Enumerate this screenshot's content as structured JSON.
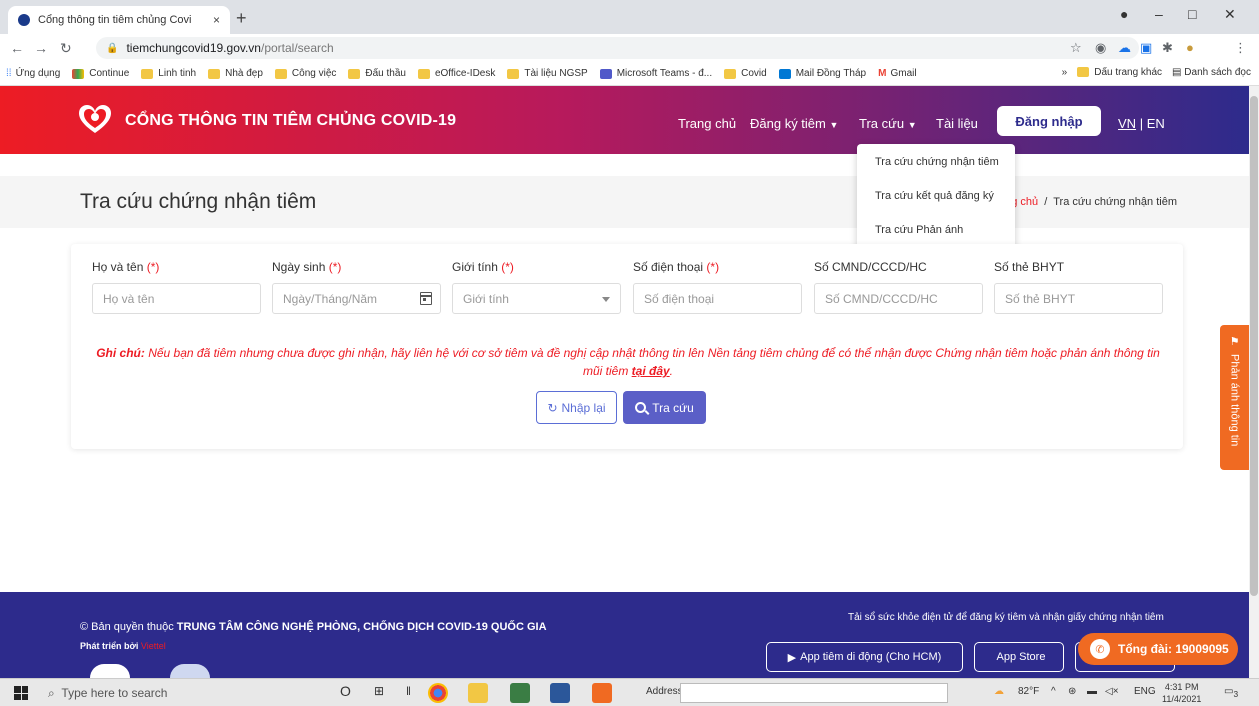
{
  "browser": {
    "tab_title": "Cổng thông tin tiêm chủng Covi",
    "tab_close": "×",
    "new_tab": "+",
    "url_host": "tiemchungcovid19.gov.vn",
    "url_path": "/portal/search",
    "bookmarks": [
      "Ứng dụng",
      "Continue",
      "Linh tinh",
      "Nhà đẹp",
      "Công việc",
      "Đấu thầu",
      "eOffice-IDesk",
      "Tài liệu NGSP",
      "Microsoft Teams - đ...",
      "Covid",
      "Mail Đồng Tháp",
      "Gmail"
    ],
    "bookmarks_more": "»",
    "bookmarks_other": "Dấu trang khác",
    "reading_list": "Danh sách đọc"
  },
  "header": {
    "site_title": "CỔNG THÔNG TIN TIÊM CHỦNG COVID-19",
    "nav": {
      "home": "Trang chủ",
      "register": "Đăng ký tiêm",
      "lookup": "Tra cứu",
      "docs": "Tài liệu"
    },
    "login": "Đăng nhập",
    "lang_vn": "VN",
    "lang_sep": "|",
    "lang_en": "EN"
  },
  "dropdown": {
    "items": [
      "Tra cứu chứng nhận tiêm",
      "Tra cứu kết quả đăng ký",
      "Tra cứu Phản ánh"
    ]
  },
  "page": {
    "title": "Tra cứu chứng nhận tiêm",
    "breadcrumb_home": "g chủ",
    "breadcrumb_sep": "/",
    "breadcrumb_current": "Tra cứu chứng nhận tiêm"
  },
  "form": {
    "fields": [
      {
        "label": "Họ và tên",
        "required": "(*)",
        "placeholder": "Họ và tên"
      },
      {
        "label": "Ngày sinh",
        "required": "(*)",
        "placeholder": "Ngày/Tháng/Năm"
      },
      {
        "label": "Giới tính",
        "required": "(*)",
        "placeholder": "Giới tính"
      },
      {
        "label": "Số điện thoại",
        "required": "(*)",
        "placeholder": "Số điện thoại"
      },
      {
        "label": "Số CMND/CCCD/HC",
        "required": "",
        "placeholder": "Số CMND/CCCD/HC"
      },
      {
        "label": "Số thẻ BHYT",
        "required": "",
        "placeholder": "Số thẻ BHYT"
      }
    ],
    "note_prefix": "Ghi chú:",
    "note_text": " Nếu bạn đã tiêm nhưng chưa được ghi nhận, hãy liên hệ với cơ sở tiêm và đề nghị cập nhật thông tin lên Nền tảng tiêm chủng để có thể nhận được Chứng nhận tiêm hoặc phản ánh thông tin mũi tiêm ",
    "note_link": "tại đây",
    "note_end": ".",
    "reset_label": "Nhập lại",
    "search_label": "Tra cứu"
  },
  "side_tab": {
    "label": "Phản ánh thông tin"
  },
  "footer": {
    "copyright_prefix": "© Bản quyền thuộc ",
    "copyright_org": "TRUNG TÂM CÔNG NGHỆ PHÒNG, CHỐNG DỊCH COVID-19 QUỐC GIA",
    "dev_prefix": "Phát triển bởi ",
    "dev_brand": "Viettel",
    "app_note": "Tải sổ sức khỏe điện tử để đăng ký tiêm và nhận giấy chứng nhận tiêm",
    "app_hcm": "App tiêm di động (Cho HCM)",
    "app_store": "App Store",
    "hotline": "Tổng đài: 19009095"
  },
  "taskbar": {
    "search_placeholder": "Type here to search",
    "address_label": "Address",
    "weather": "82°F",
    "lang": "ENG",
    "time": "4:31 PM",
    "date": "11/4/2021",
    "notif_count": "3"
  },
  "colors": {
    "accent_red": "#ed1c24",
    "accent_navy": "#2d2b8c",
    "button_blue": "#5b5fc7",
    "orange": "#f06a22"
  }
}
